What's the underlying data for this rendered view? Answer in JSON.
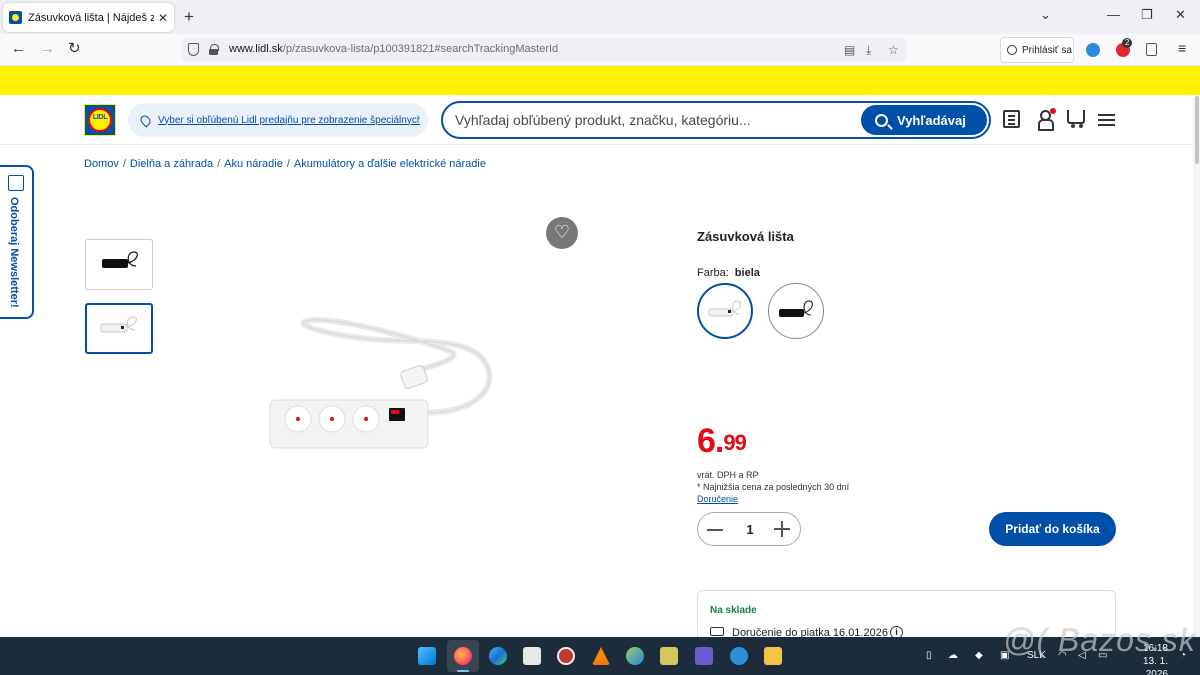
{
  "browser": {
    "tab_title": "Zásuvková lišta | Nájdeš za skve",
    "tab_close": "✕",
    "new_tab": "+",
    "url_domain": "www.lidl.sk",
    "url_path": "/p/zasuvkova-lista/p100391821#searchTrackingMasterId",
    "signin_label": "Prihlásiť sa",
    "extension_badge": "2"
  },
  "header": {
    "logo_text": "LIDL",
    "store_prompt": "Vyber si obľúbenú Lidl predajňu pre zobrazenie špeciálnych ponúk",
    "search_placeholder": "Vyhľadaj obľúbený produkt, značku, kategóriu...",
    "search_button": "Vyhľadávaj"
  },
  "breadcrumb": [
    "Domov",
    "Dielňa a záhrada",
    "Aku náradie",
    "Akumulátory a ďalšie elektrické náradie"
  ],
  "newsletter": {
    "label": "Odoberaj Newsletter!"
  },
  "product": {
    "title": "Zásuvková lišta",
    "color_label": "Farba:",
    "color_value": "biela",
    "price_main": "6.",
    "price_cents": "99",
    "vat_note": "vrát. DPH a RP",
    "lowest_price_note": "* Najnižšia cena za posledných 30 dní",
    "delivery_link": "Doručenie",
    "quantity": "1",
    "add_to_cart": "Pridať do košíka",
    "stock_status": "Na sklade",
    "delivery_info": "Doručenie do piatka 16.01.2026",
    "info_glyph": "i",
    "wishlist_glyph": "♡"
  },
  "taskbar": {
    "language": "SLK",
    "time": "16:18",
    "date": "13. 1. 2026"
  },
  "watermark": "@( Bazos.sk",
  "colors": {
    "lidl_blue": "#0050aa",
    "lidl_yellow": "#fff000",
    "lidl_red": "#e60a14",
    "taskbar": "#1c2c3a"
  },
  "icons": [
    "shield-icon",
    "lock-icon",
    "search-icon",
    "location-pin-icon",
    "newspaper-icon",
    "user-icon",
    "cart-icon",
    "menu-icon",
    "heart-icon",
    "truck-icon",
    "info-icon",
    "newsletter-icon"
  ]
}
